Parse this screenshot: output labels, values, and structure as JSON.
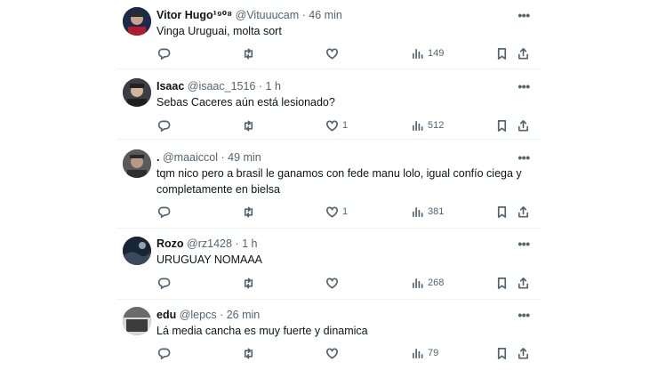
{
  "tweets": [
    {
      "name": "Vitor Hugo¹⁹⁰⁸",
      "handle": "@Vituuucam",
      "sep": "·",
      "time": "46 min",
      "text": "Vinga Uruguai, molta sort",
      "replies": "",
      "retweets": "",
      "likes": "",
      "views": "149",
      "avatar_color": "#1b2a4a"
    },
    {
      "name": "Isaac",
      "handle": "@isaac_1516",
      "sep": "·",
      "time": "1 h",
      "text": "Sebas Caceres aún está lesionado?",
      "replies": "",
      "retweets": "",
      "likes": "1",
      "views": "512",
      "avatar_color": "#3b3f45"
    },
    {
      "name": ".",
      "handle": "@maaiccol",
      "sep": "·",
      "time": "49 min",
      "text": "tqm nico pero a brasil le ganamos con fede manu lolo, igual confío ciega y completamente en bielsa",
      "replies": "",
      "retweets": "",
      "likes": "1",
      "views": "381",
      "avatar_color": "#5a5a5a"
    },
    {
      "name": "Rozo",
      "handle": "@rz1428",
      "sep": "·",
      "time": "1 h",
      "text": "URUGUAY NOMAAA",
      "replies": "",
      "retweets": "",
      "likes": "",
      "views": "268",
      "avatar_color": "#1a2533"
    },
    {
      "name": "edu",
      "handle": "@lepcs",
      "sep": "·",
      "time": "26 min",
      "text": "Lá media cancha es muy fuerte y dinamica",
      "replies": "",
      "retweets": "",
      "likes": "",
      "views": "79",
      "avatar_color": "#6b6b6b"
    }
  ],
  "icons": {
    "more": "more-horizontal-icon",
    "reply": "reply-icon",
    "retweet": "retweet-icon",
    "like": "heart-icon",
    "views": "views-icon",
    "bookmark": "bookmark-icon",
    "share": "share-icon"
  }
}
